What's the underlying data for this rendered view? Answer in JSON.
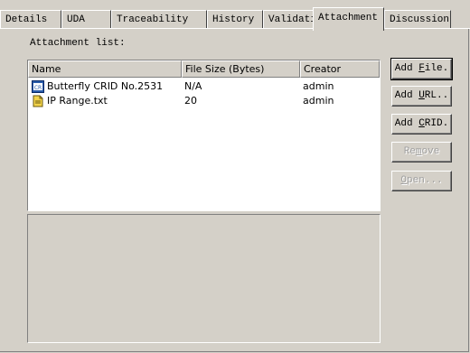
{
  "tabs": [
    {
      "label": "Details",
      "active": false
    },
    {
      "label": "UDA",
      "active": false
    },
    {
      "label": "Traceability",
      "active": false
    },
    {
      "label": "History",
      "active": false
    },
    {
      "label": "Validation",
      "active": false
    },
    {
      "label": "Attachment",
      "active": true
    },
    {
      "label": "Discussion",
      "active": false
    }
  ],
  "attachments": {
    "label": "Attachment list:",
    "columns": [
      "Name",
      "File Size (Bytes)",
      "Creator"
    ],
    "rows": [
      {
        "icon": "crid-icon",
        "name": "Butterfly CRID No.2531",
        "size": "N/A",
        "creator": "admin"
      },
      {
        "icon": "text-file-icon",
        "name": "IP Range.txt",
        "size": "20",
        "creator": "admin"
      }
    ]
  },
  "buttons": {
    "add_file": {
      "pre": "Add ",
      "key": "F",
      "post": "ile."
    },
    "add_url": {
      "pre": "Add ",
      "key": "U",
      "post": "RL.."
    },
    "add_crid": {
      "pre": "Add ",
      "key": "C",
      "post": "RID."
    },
    "remove": {
      "pre": "Re",
      "key": "m",
      "post": "ove"
    },
    "open": {
      "pre": "",
      "key": "O",
      "post": "pen..."
    }
  },
  "colors": {
    "face": "#d4d0c8",
    "disabled_text": "#a0a0a0",
    "crid_icon": "#2a5caa",
    "text_file_icon": "#f2d34a"
  }
}
